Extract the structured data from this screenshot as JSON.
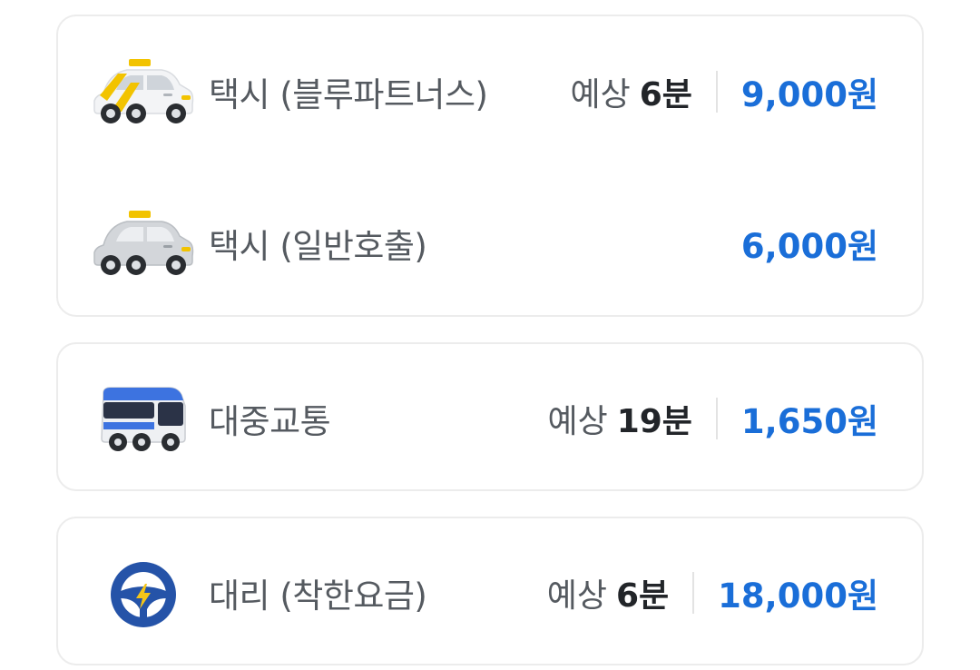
{
  "options": [
    {
      "label": "택시 (블루파트너스)",
      "icon": "blue-partners-taxi-icon",
      "eta_prefix": "예상",
      "eta_value": "6분",
      "price": "9,000원"
    },
    {
      "label": "택시 (일반호출)",
      "icon": "general-taxi-icon",
      "price": "6,000원"
    },
    {
      "label": "대중교통",
      "icon": "bus-icon",
      "eta_prefix": "예상",
      "eta_value": "19분",
      "price": "1,650원"
    },
    {
      "label": "대리 (착한요금)",
      "icon": "steering-wheel-icon",
      "eta_prefix": "예상",
      "eta_value": "6분",
      "price": "18,000원"
    }
  ],
  "colors": {
    "price": "#1a6ed8",
    "label": "#555a60",
    "border": "#ececec",
    "wheel_blue": "#2553a8",
    "bolt_yellow": "#f5c518"
  }
}
